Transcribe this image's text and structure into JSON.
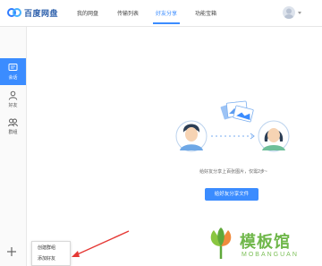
{
  "app": {
    "name": "百度网盘"
  },
  "nav": {
    "tabs": [
      {
        "label": "我的网盘"
      },
      {
        "label": "传输列表"
      },
      {
        "label": "好友分享",
        "active": true
      },
      {
        "label": "功能宝箱"
      }
    ]
  },
  "sidebar": {
    "items": [
      {
        "label": "会话",
        "icon": "chat-icon",
        "active": true
      },
      {
        "label": "好友",
        "icon": "user-icon"
      },
      {
        "label": "群组",
        "icon": "group-icon"
      }
    ],
    "add_icon": "plus-icon"
  },
  "main": {
    "hint": "给好友分享上百张图片，仅需2步~",
    "share_button": "给好友分享文件"
  },
  "popup": {
    "items": [
      {
        "label": "创建群组"
      },
      {
        "label": "添加好友"
      }
    ]
  },
  "watermark": {
    "name_cn": "模板馆",
    "name_en": "MOBANGUAN"
  },
  "colors": {
    "accent": "#3b8cff",
    "brand_text": "#2c5fab",
    "arrow": "#e53935",
    "watermark": "#6fb74a"
  }
}
